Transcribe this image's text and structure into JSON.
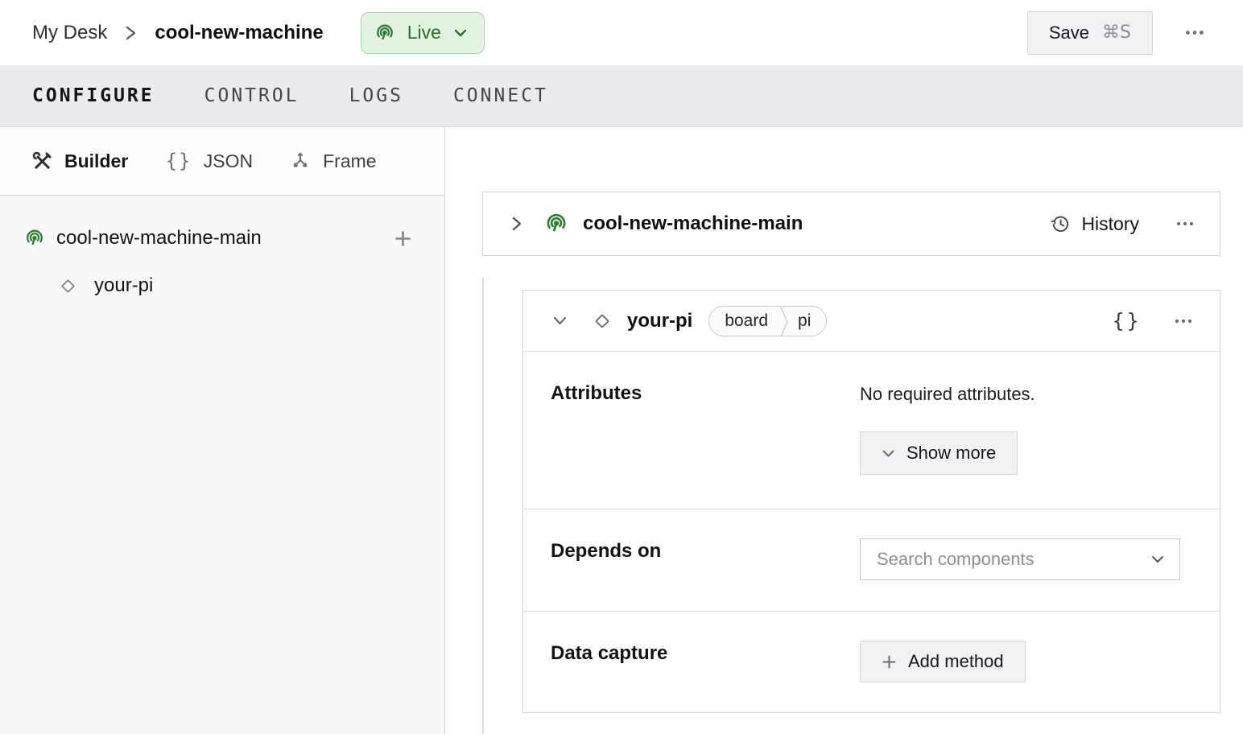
{
  "header": {
    "breadcrumb": {
      "parent": "My Desk",
      "current": "cool-new-machine"
    },
    "live_badge": {
      "label": "Live"
    },
    "save_button": {
      "label": "Save",
      "shortcut": "⌘S"
    }
  },
  "tabs": [
    {
      "label": "CONFIGURE",
      "active": true
    },
    {
      "label": "CONTROL",
      "active": false
    },
    {
      "label": "LOGS",
      "active": false
    },
    {
      "label": "CONNECT",
      "active": false
    }
  ],
  "sidebar": {
    "views": [
      {
        "label": "Builder",
        "icon": "tools-icon",
        "active": true
      },
      {
        "label": "JSON",
        "icon": "braces-icon",
        "active": false
      },
      {
        "label": "Frame",
        "icon": "frame-icon",
        "active": false
      }
    ],
    "tree": {
      "root": {
        "label": "cool-new-machine-main",
        "icon": "live-icon"
      },
      "child": {
        "label": "your-pi",
        "icon": "component-icon"
      }
    }
  },
  "main": {
    "part_card": {
      "title": "cool-new-machine-main",
      "history_label": "History"
    },
    "component_card": {
      "title": "your-pi",
      "badge": {
        "type": "board",
        "model": "pi"
      },
      "attributes": {
        "label": "Attributes",
        "empty_text": "No required attributes.",
        "show_more": "Show more"
      },
      "depends_on": {
        "label": "Depends on",
        "placeholder": "Search components"
      },
      "data_capture": {
        "label": "Data capture",
        "add_method": "Add method"
      }
    }
  },
  "icons": {
    "braces_glyph": "{}"
  },
  "colors": {
    "accent_green": "#2e7d32",
    "live_badge_bg": "#e3f3e2",
    "live_badge_border": "#a6d7a4",
    "live_badge_text": "#276b2b",
    "tabbar_bg": "#ebebef",
    "card_border": "#d5d5d9",
    "button_bg": "#f2f2f4"
  }
}
